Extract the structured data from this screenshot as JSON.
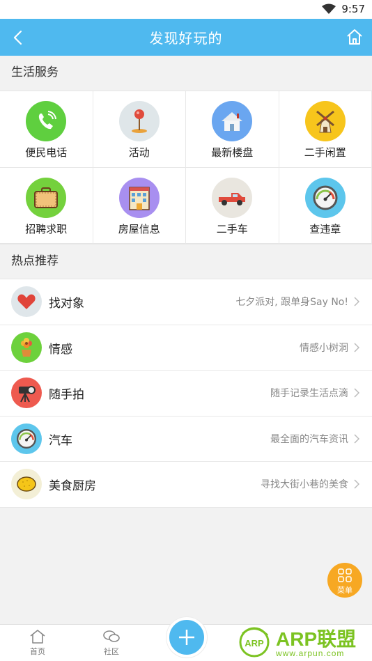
{
  "status_bar": {
    "time": "9:57"
  },
  "header": {
    "title": "发现好玩的"
  },
  "sections": {
    "life": "生活服务",
    "hot": "热点推荐"
  },
  "services": [
    {
      "label": "便民电话",
      "icon": "phone-icon",
      "color": "#5fcf3f"
    },
    {
      "label": "活动",
      "icon": "map-pin-icon",
      "color": "#dfe6e9"
    },
    {
      "label": "最新楼盘",
      "icon": "house-icon",
      "color": "#6aa6f0"
    },
    {
      "label": "二手闲置",
      "icon": "windmill-icon",
      "color": "#f7c51c"
    },
    {
      "label": "招聘求职",
      "icon": "briefcase-icon",
      "color": "#74d13d"
    },
    {
      "label": "房屋信息",
      "icon": "building-icon",
      "color": "#a88ff0"
    },
    {
      "label": "二手车",
      "icon": "pickup-truck-icon",
      "color": "#e9e6df"
    },
    {
      "label": "查违章",
      "icon": "speedometer-icon",
      "color": "#5dc6ec"
    }
  ],
  "hot_items": [
    {
      "title": "找对象",
      "desc": "七夕派对, 跟单身Say No!",
      "icon": "heart-icon",
      "color": "#dfe6ea"
    },
    {
      "title": "情感",
      "desc": "情感小树洞",
      "icon": "flower-pot-icon",
      "color": "#6dd13c"
    },
    {
      "title": "随手拍",
      "desc": "随手记录生活点滴",
      "icon": "camera-tripod-icon",
      "color": "#ee5a4f"
    },
    {
      "title": "汽车",
      "desc": "最全面的汽车资讯",
      "icon": "speedometer-icon",
      "color": "#5dc6ec"
    },
    {
      "title": "美食厨房",
      "desc": "寻找大街小巷的美食",
      "icon": "lemon-icon",
      "color": "#f3efd6"
    }
  ],
  "menu_fab": {
    "label": "菜单"
  },
  "tabbar": {
    "home": "首页",
    "community": "社区"
  },
  "watermark": {
    "brand": "ARP联盟",
    "url": "www.arpun.com",
    "logo_text": "ARP"
  }
}
